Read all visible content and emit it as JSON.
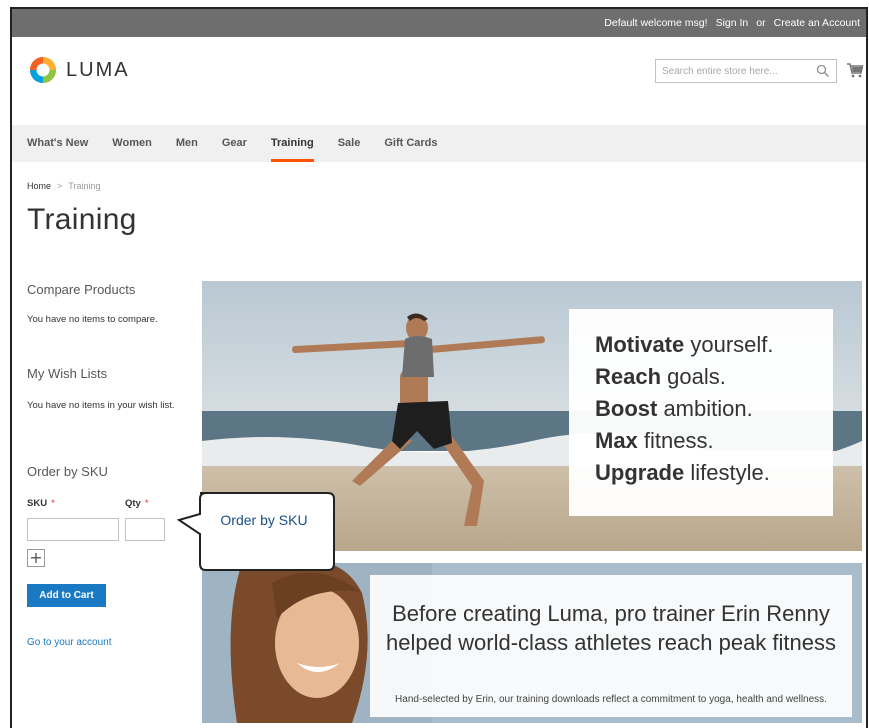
{
  "top_panel": {
    "welcome": "Default welcome msg!",
    "sign_in": "Sign In",
    "or": "or",
    "create_account": "Create an Account"
  },
  "header": {
    "logo_text": "LUMA",
    "search_placeholder": "Search entire store here...",
    "cart_icon": "cart-icon",
    "search_icon": "search-icon"
  },
  "nav": {
    "items": [
      {
        "label": "What's New"
      },
      {
        "label": "Women"
      },
      {
        "label": "Men"
      },
      {
        "label": "Gear"
      },
      {
        "label": "Training",
        "active": true
      },
      {
        "label": "Sale"
      },
      {
        "label": "Gift Cards"
      }
    ]
  },
  "breadcrumb": {
    "home": "Home",
    "separator": ">",
    "current": "Training"
  },
  "page_title": "Training",
  "sidebar": {
    "compare": {
      "title": "Compare Products",
      "text": "You have no items to compare."
    },
    "wishlist": {
      "title": "My Wish Lists",
      "text": "You have no items in your wish list."
    },
    "order_by_sku": {
      "title": "Order by SKU",
      "sku_label": "SKU",
      "qty_label": "Qty",
      "required_mark": "*",
      "sku_value": "",
      "qty_value": "",
      "plus_label": "+",
      "add_to_cart": "Add to Cart",
      "account_link": "Go to your account"
    }
  },
  "callout": {
    "text": "Order by SKU"
  },
  "hero": {
    "lines": [
      {
        "bold": "Motivate",
        "rest": " yourself."
      },
      {
        "bold": "Reach",
        "rest": " goals."
      },
      {
        "bold": "Boost",
        "rest": " ambition."
      },
      {
        "bold": "Max",
        "rest": " fitness."
      },
      {
        "bold": "Upgrade",
        "rest": " lifestyle."
      }
    ]
  },
  "banner2": {
    "title": "Before creating Luma, pro trainer Erin Renny helped world-class athletes reach peak fitness",
    "subtitle": "Hand-selected by Erin, our training downloads reflect a commitment to yoga, health and wellness."
  },
  "colors": {
    "accent": "#ff5501",
    "link": "#1979c3",
    "top_panel": "#6e6e6e",
    "nav_bg": "#f0f0f0",
    "callout_text": "#1a4f8a"
  }
}
